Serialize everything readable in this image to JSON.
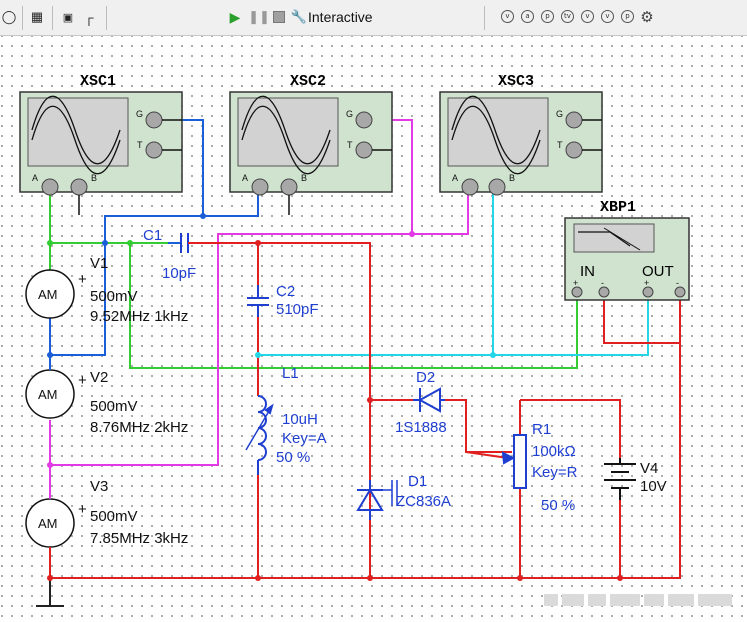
{
  "toolbar": {
    "simulate_mode": "Interactive",
    "icons": [
      "circle-icon",
      "component-icon",
      "subcircuit-icon",
      "probe-icon",
      "run-icon",
      "pause-icon",
      "stop-icon",
      "wrench-icon"
    ],
    "right_icons": [
      "v",
      "a",
      "p",
      "tv",
      "v",
      "v",
      "p",
      "gear"
    ]
  },
  "instruments": {
    "xsc1": "XSC1",
    "xsc2": "XSC2",
    "xsc3": "XSC3",
    "xbp1": "XBP1",
    "scope_terminal_g": "G",
    "scope_terminal_t": "T",
    "scope_terminal_a": "A",
    "scope_terminal_b": "B",
    "bode_in": "IN",
    "bode_out": "OUT"
  },
  "sources": {
    "v1": {
      "name": "V1",
      "amplitude": "500mV",
      "freq": "9.52MHz 1kHz"
    },
    "v2": {
      "name": "V2",
      "amplitude": "500mV",
      "freq": "8.76MHz 2kHz"
    },
    "v3": {
      "name": "V3",
      "amplitude": "500mV",
      "freq": "7.85MHz 3kHz"
    },
    "am_symbol": "AM",
    "plus": "+"
  },
  "components": {
    "c1": {
      "name": "C1",
      "value": "10pF"
    },
    "c2": {
      "name": "C2",
      "value": "510pF"
    },
    "l1": {
      "name": "L1",
      "value": "10uH",
      "key": "Key=A",
      "percent": "50 %"
    },
    "d2": {
      "name": "D2",
      "value": "1S1888"
    },
    "d1": {
      "name": "D1",
      "value": "ZC836A"
    },
    "r1": {
      "name": "R1",
      "value": "100kΩ",
      "key": "Key=R",
      "percent": "50 %"
    },
    "v4": {
      "name": "V4",
      "value": "10V"
    }
  },
  "colors": {
    "wire_green": "#33cc33",
    "wire_blue": "#1a5fd6",
    "wire_magenta": "#e23be6",
    "wire_cyan": "#22d6e6",
    "wire_red": "#e02020",
    "instrument_fill": "#cfe3cf",
    "component_blue": "#1f3fd1"
  }
}
